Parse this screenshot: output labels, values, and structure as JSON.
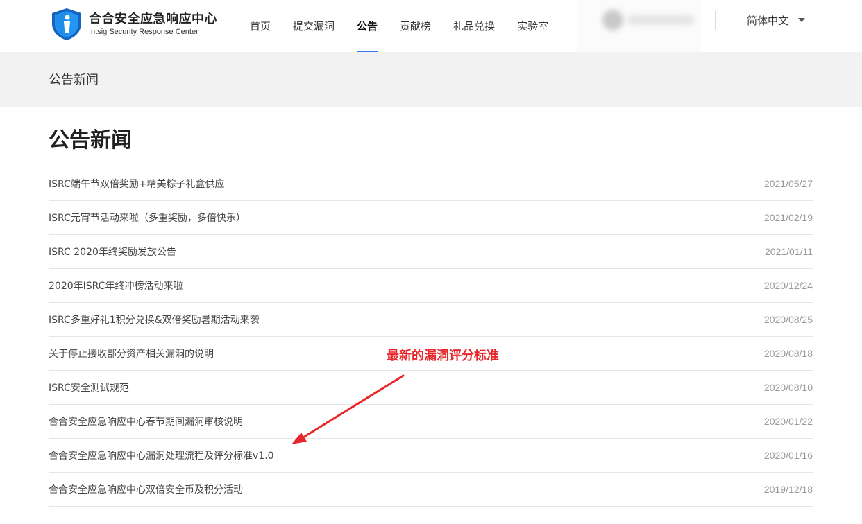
{
  "header": {
    "logo_cn": "合合安全应急响应中心",
    "logo_en": "Intsig Security Response Center",
    "nav": [
      {
        "label": "首页",
        "active": false
      },
      {
        "label": "提交漏洞",
        "active": false
      },
      {
        "label": "公告",
        "active": true
      },
      {
        "label": "贡献榜",
        "active": false
      },
      {
        "label": "礼品兑换",
        "active": false
      },
      {
        "label": "实验室",
        "active": false
      }
    ],
    "language": "简体中文"
  },
  "banner": {
    "title": "公告新闻"
  },
  "main": {
    "title": "公告新闻",
    "news": [
      {
        "title": "ISRC端午节双倍奖励+精美粽子礼盒供应",
        "date": "2021/05/27"
      },
      {
        "title": "ISRC元宵节活动来啦（多重奖励，多倍快乐）",
        "date": "2021/02/19"
      },
      {
        "title": "ISRC 2020年终奖励发放公告",
        "date": "2021/01/11"
      },
      {
        "title": "2020年ISRC年终冲榜活动来啦",
        "date": "2020/12/24"
      },
      {
        "title": "ISRC多重好礼1积分兑换&双倍奖励暑期活动来袭",
        "date": "2020/08/25"
      },
      {
        "title": "关于停止接收部分资产相关漏洞的说明",
        "date": "2020/08/18"
      },
      {
        "title": "ISRC安全测试规范",
        "date": "2020/08/10"
      },
      {
        "title": "合合安全应急响应中心春节期间漏洞审核说明",
        "date": "2020/01/22"
      },
      {
        "title": "合合安全应急响应中心漏洞处理流程及评分标准v1.0",
        "date": "2020/01/16"
      },
      {
        "title": "合合安全应急响应中心双倍安全币及积分活动",
        "date": "2019/12/18"
      }
    ]
  },
  "annotation": {
    "text": "最新的漏洞评分标准",
    "color": "#e8262a"
  },
  "colors": {
    "accent": "#2d7be5",
    "logo_blue": "#1565c0"
  }
}
